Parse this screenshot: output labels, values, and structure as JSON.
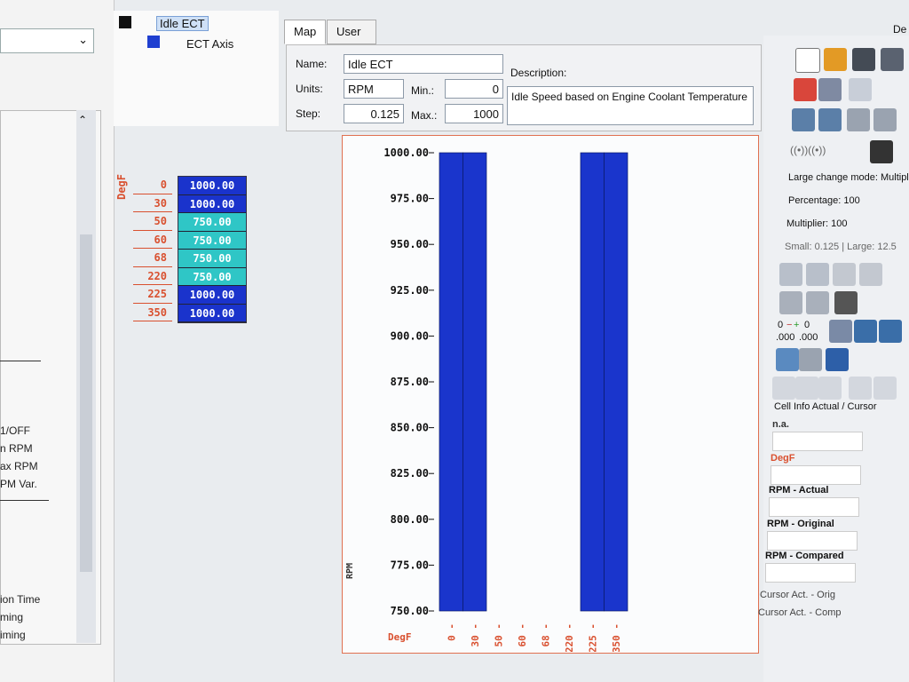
{
  "tree": {
    "root_label": "Idle ECT",
    "child_label": "ECT Axis"
  },
  "tabs": [
    {
      "label": "Map"
    },
    {
      "label": "User Notes"
    }
  ],
  "map_info": {
    "name_label": "Name:",
    "name_value": "Idle ECT",
    "units_label": "Units:",
    "units_value": "RPM",
    "step_label": "Step:",
    "step_value": "0.125",
    "min_label": "Min.:",
    "min_value": "0",
    "max_label": "Max.:",
    "max_value": "1000",
    "description_label": "Description:",
    "description_value": "Idle Speed based on Engine Coolant Temperature"
  },
  "table": {
    "axis_label": "DegF",
    "axis_values": [
      "0",
      "30",
      "50",
      "60",
      "68",
      "220",
      "225",
      "350"
    ],
    "cell_values": [
      "1000.00",
      "1000.00",
      "750.00",
      "750.00",
      "750.00",
      "750.00",
      "1000.00",
      "1000.00"
    ],
    "colors": {
      "high": "#1a33cc",
      "low": "#2fc6c6"
    }
  },
  "left_panel": {
    "items": [
      "1/OFF",
      "n RPM",
      "ax RPM",
      "PM Var.",
      "ion Time",
      "ming",
      "iming"
    ]
  },
  "chart_data": {
    "type": "bar",
    "categories": [
      "0",
      "30",
      "50",
      "60",
      "68",
      "220",
      "225",
      "350"
    ],
    "series": [
      {
        "values": [
          1000,
          1000,
          750,
          750,
          750,
          750,
          1000,
          1000
        ]
      }
    ],
    "xlabel": "DegF",
    "ylabel": "RPM",
    "ylim": [
      750,
      1000
    ],
    "yticks": [
      "1000.00",
      "975.00",
      "950.00",
      "925.00",
      "900.00",
      "875.00",
      "850.00",
      "825.00",
      "800.00",
      "775.00",
      "750.00"
    ],
    "colors": {
      "high": "#1a35cc",
      "low": "#2fc0c0"
    }
  },
  "right_panel": {
    "large_change_mode": "Large change mode: Multiplie",
    "percentage": "Percentage: 100",
    "multiplier": "Multiplier: 100",
    "small_large": "Small: 0.125 | Large: 12.5",
    "zero_a": "0",
    "zero_b": "0",
    "dec_a": ".000",
    "dec_b": ".000",
    "cell_info_title": "Cell Info Actual / Cursor",
    "na": "n.a.",
    "degf": "DegF",
    "rpm_actual": "RPM - Actual",
    "rpm_original": "RPM - Original",
    "rpm_compared": "RPM - Compared",
    "cursor_act_orig": "Cursor Act. - Orig",
    "cursor_act_comp": "Cursor Act. - Comp",
    "corner_text": "De"
  }
}
